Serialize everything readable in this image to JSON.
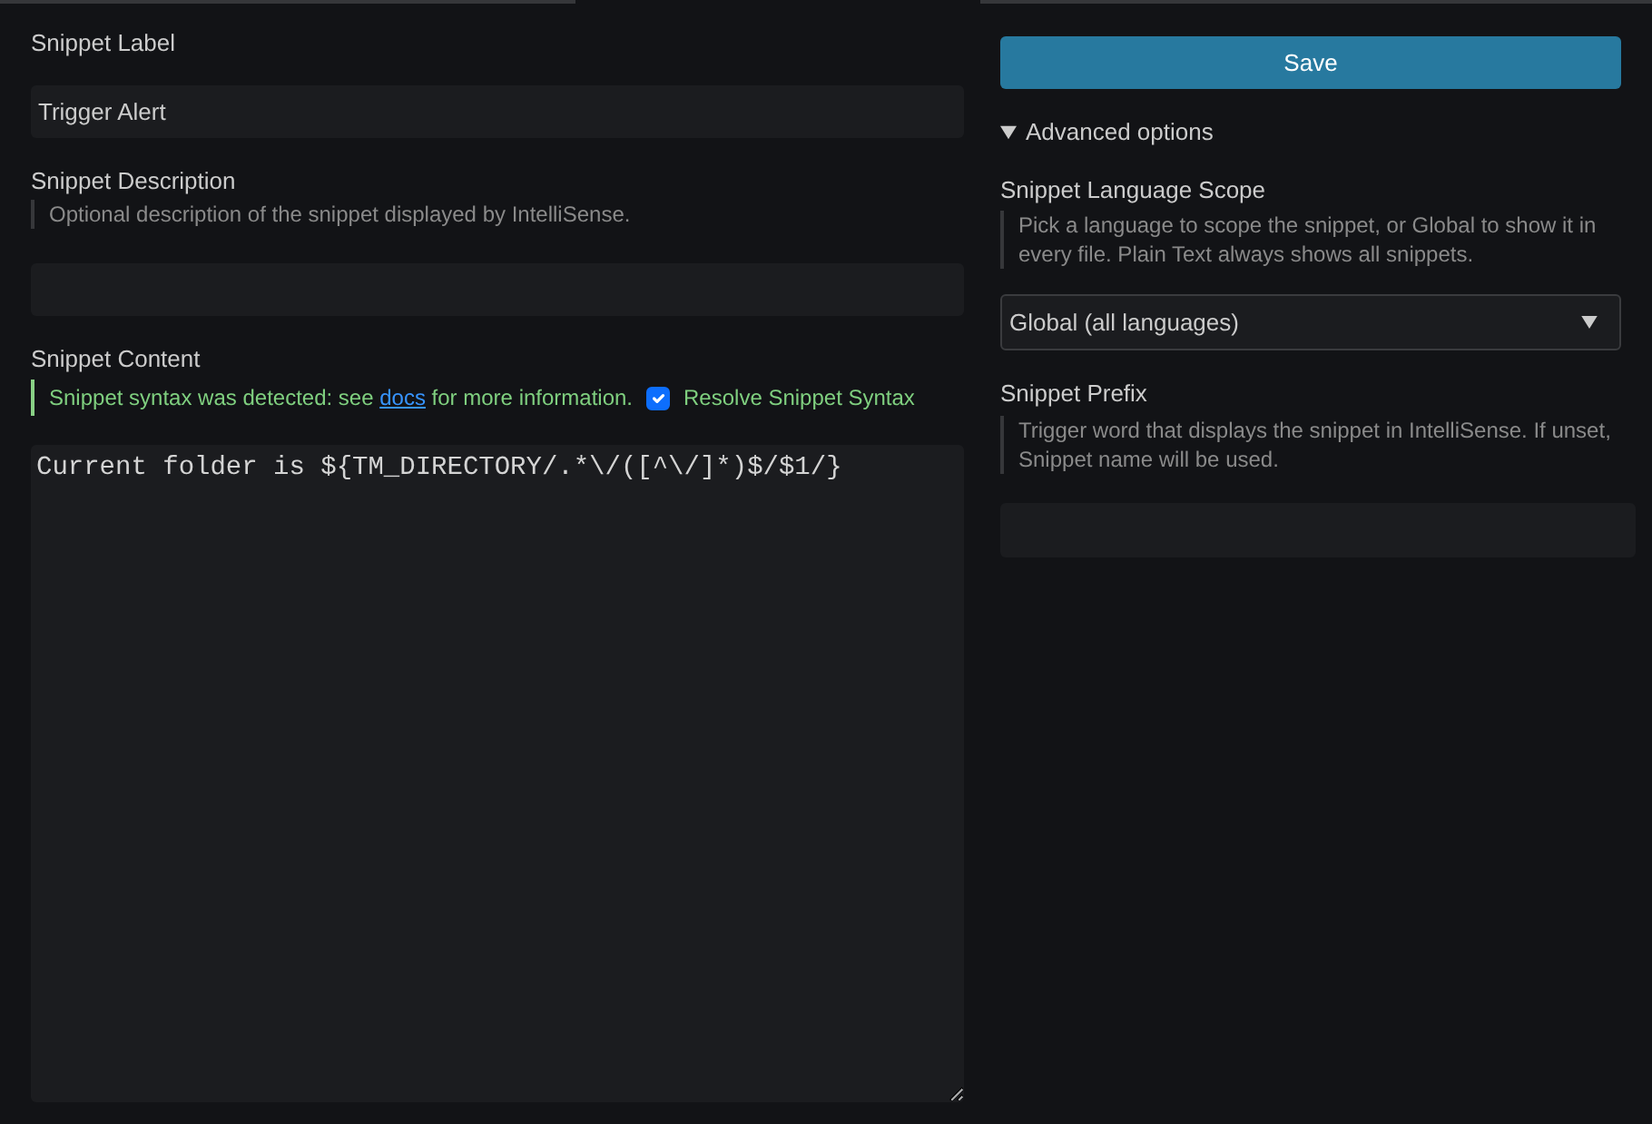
{
  "snippet_label": {
    "label": "Snippet Label",
    "value": "Trigger Alert"
  },
  "snippet_description": {
    "label": "Snippet Description",
    "hint": "Optional description of the snippet displayed by IntelliSense."
  },
  "snippet_content": {
    "label": "Snippet Content",
    "notice": {
      "before": "Snippet syntax was detected: see ",
      "link": "docs",
      "after": " for more information."
    },
    "resolve_checkbox": {
      "label": "Resolve Snippet Syntax",
      "checked": true
    },
    "value": "Current folder is ${TM_DIRECTORY/.*\\/([^\\/]*)$/$1/}"
  },
  "save_button": {
    "label": "Save"
  },
  "advanced_options": {
    "label": "Advanced options",
    "expanded": true,
    "language_scope": {
      "label": "Snippet Language Scope",
      "hint": "Pick a language to scope the snippet, or Global to show it in every file. Plain Text always shows all snippets.",
      "value": "Global (all languages)"
    },
    "snippet_prefix": {
      "label": "Snippet Prefix",
      "hint": "Trigger word that displays the snippet in IntelliSense. If unset, Snippet name will be used."
    }
  }
}
